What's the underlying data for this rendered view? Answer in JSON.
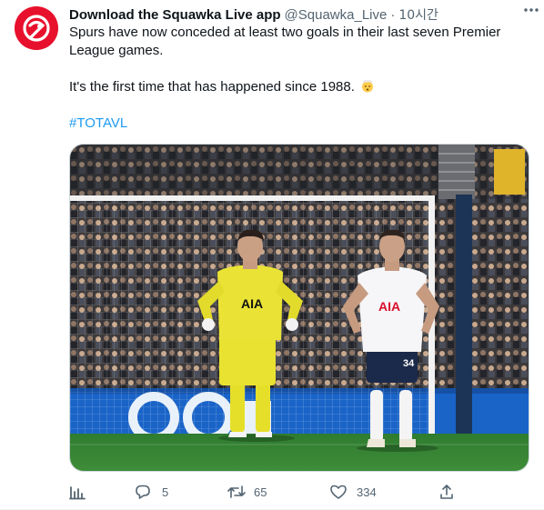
{
  "author": {
    "display_name": "Download the Squawka Live app",
    "handle": "@Squawka_Live",
    "separator": "·",
    "time": "10시간",
    "brand_color": "#e8112d"
  },
  "tweet": {
    "line1": "Spurs have now conceded at least two goals in their last seven Premier League games.",
    "line2": "It's the first time that has happened since 1988.",
    "emoji": "exploding-head-emoji",
    "hashtag": "#TOTAVL",
    "link_color": "#1d9bf0"
  },
  "media": {
    "description_icon": "photo",
    "shirt_sponsor": "AIA",
    "player_number": "34"
  },
  "actions": {
    "analytics_icon": "bar-chart-icon",
    "replies": "5",
    "retweets": "65",
    "likes": "334",
    "share_icon": "share-icon"
  }
}
